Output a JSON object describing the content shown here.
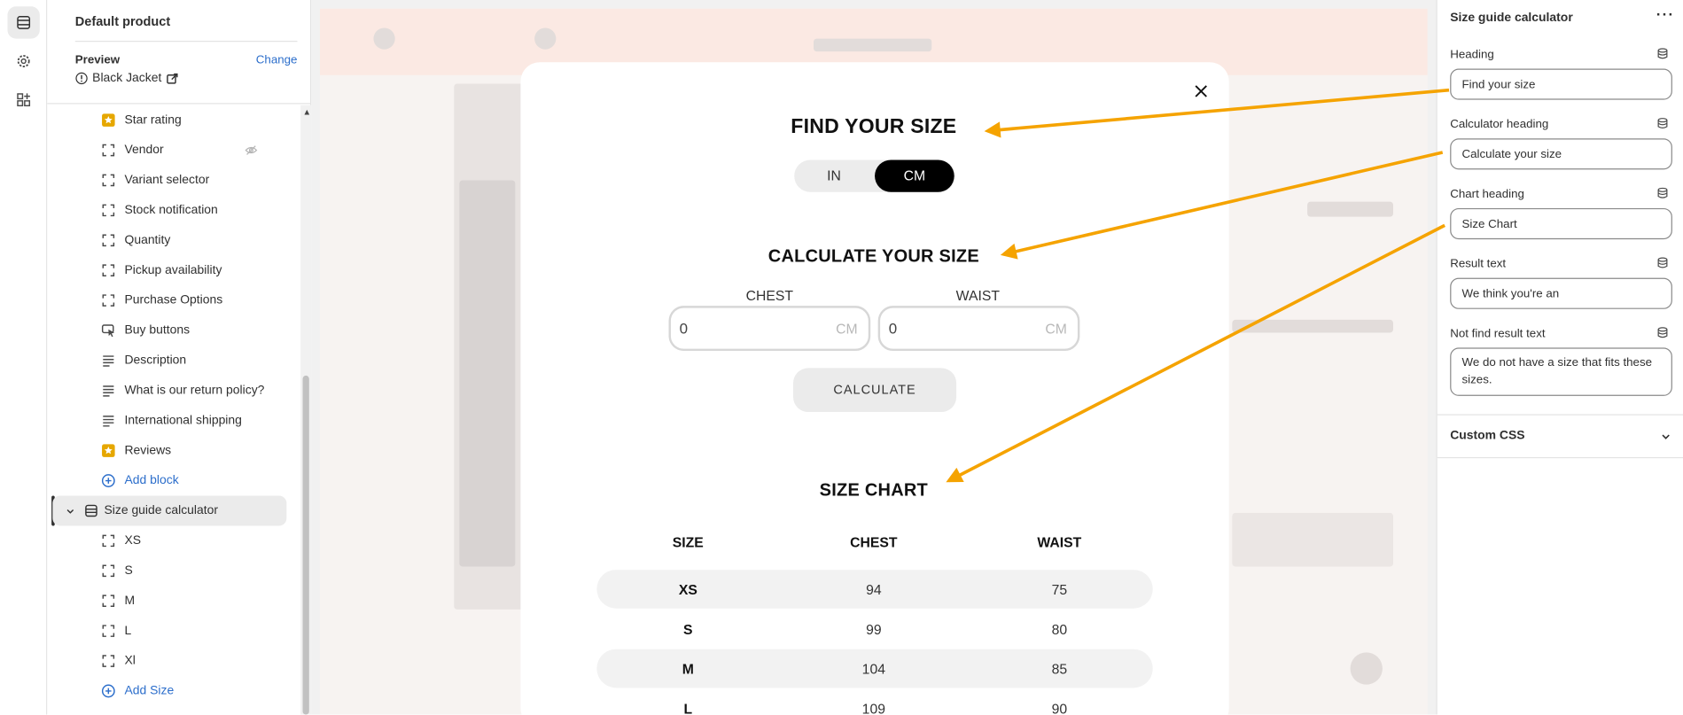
{
  "sidebar": {
    "title": "Default product",
    "preview_label": "Preview",
    "change_label": "Change",
    "preview_value": "Black Jacket",
    "blocks": [
      {
        "label": "Star rating",
        "icon": "star-icon"
      },
      {
        "label": "Vendor",
        "icon": "block-icon"
      },
      {
        "label": "Variant selector",
        "icon": "block-icon"
      },
      {
        "label": "Stock notification",
        "icon": "block-icon"
      },
      {
        "label": "Quantity",
        "icon": "block-icon"
      },
      {
        "label": "Pickup availability",
        "icon": "block-icon"
      },
      {
        "label": "Purchase Options",
        "icon": "block-icon"
      },
      {
        "label": "Buy buttons",
        "icon": "cursor-icon"
      },
      {
        "label": "Description",
        "icon": "text-icon"
      },
      {
        "label": "What is our return policy?",
        "icon": "text-icon"
      },
      {
        "label": "International shipping",
        "icon": "text-icon"
      },
      {
        "label": "Reviews",
        "icon": "star-icon"
      }
    ],
    "add_block": "Add block",
    "section": "Size guide calculator",
    "sizes": [
      "XS",
      "S",
      "M",
      "L",
      "Xl"
    ],
    "add_size": "Add Size"
  },
  "modal": {
    "find_title": "FIND YOUR SIZE",
    "unit_in": "IN",
    "unit_cm": "CM",
    "calc_title": "CALCULATE YOUR SIZE",
    "chest_label": "CHEST",
    "waist_label": "WAIST",
    "chest_value": "0",
    "waist_value": "0",
    "unit_suffix": "CM",
    "calc_button": "CALCULATE",
    "chart_title": "SIZE CHART",
    "headers": [
      "SIZE",
      "CHEST",
      "WAIST"
    ],
    "rows": [
      [
        "XS",
        "94",
        "75"
      ],
      [
        "S",
        "99",
        "80"
      ],
      [
        "M",
        "104",
        "85"
      ],
      [
        "L",
        "109",
        "90"
      ]
    ]
  },
  "panel": {
    "title": "Size guide calculator",
    "more": "···",
    "fields": [
      {
        "label": "Heading",
        "value": "Find your size"
      },
      {
        "label": "Calculator heading",
        "value": "Calculate your size"
      },
      {
        "label": "Chart heading",
        "value": "Size Chart"
      },
      {
        "label": "Result text",
        "value": "We think you're an"
      },
      {
        "label": "Not find result text",
        "value": "We do not have a size that fits these sizes."
      }
    ],
    "custom_css": "Custom CSS"
  },
  "colors": {
    "arrow": "#f5a300",
    "link": "#2c6ecb",
    "star": "#e6a700"
  }
}
